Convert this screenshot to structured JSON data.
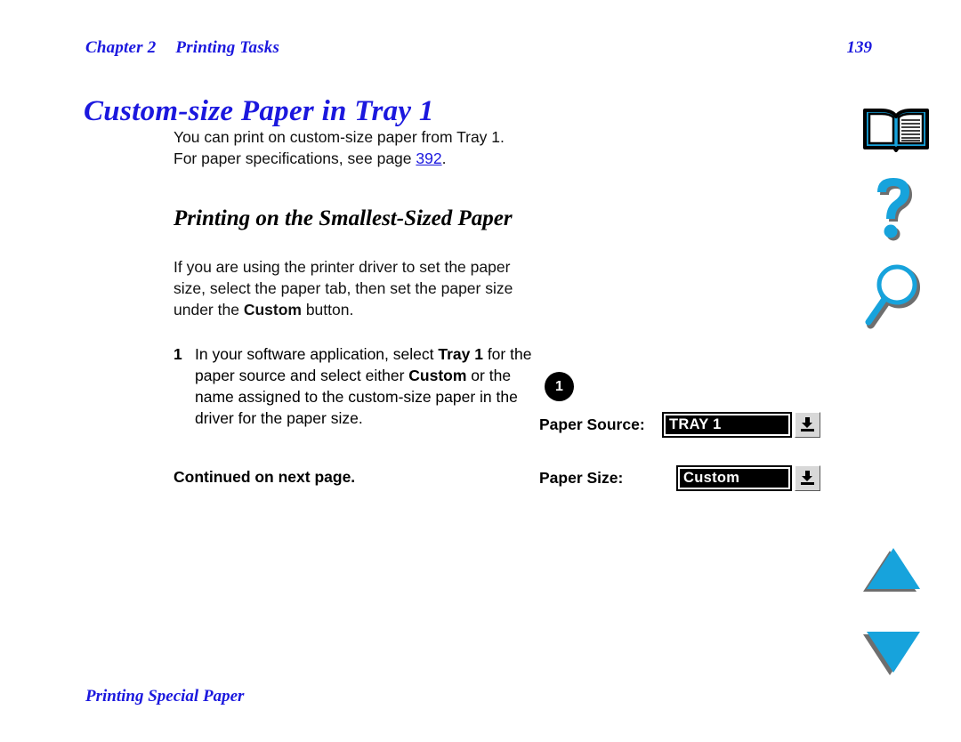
{
  "document": {
    "running_head": {
      "chapter": "Chapter 2",
      "section": "Printing Tasks"
    },
    "page_number": "139",
    "title": "Custom-size Paper in Tray 1",
    "footer": "Printing Special Paper"
  },
  "content": {
    "intro_paragraph_part1": "You can print on custom-size paper from Tray 1. For paper specifications, see page ",
    "intro_link": "392",
    "intro_paragraph_part2": ".",
    "subheading": "Printing on the Smallest-Sized Paper",
    "driver_paragraph_part1": "If you are using the printer driver to set the paper size, select the paper tab, then set the paper size under the ",
    "driver_paragraph_bold": "Custom",
    "driver_paragraph_part2": " button.",
    "step": {
      "number": "1",
      "text_part1": "In your software application, select ",
      "bold1": "Tray 1",
      "text_part2": " for the paper source and select either ",
      "bold2": "Custom",
      "text_part3": " or the name assigned to the custom-size paper in the driver for the paper size."
    },
    "continued_note": "Continued on next page."
  },
  "figure": {
    "callout_number": "1",
    "fields": [
      {
        "label": "Paper Source:",
        "value": "TRAY 1",
        "dropdown_icon": "dropdown-arrow-icon"
      },
      {
        "label": "Paper Size:",
        "value": "Custom",
        "dropdown_icon": "dropdown-arrow-icon"
      }
    ]
  },
  "icon_rail": {
    "items": [
      {
        "name": "book-icon",
        "meaning": "Table of contents"
      },
      {
        "name": "help-icon",
        "meaning": "Help"
      },
      {
        "name": "search-icon",
        "meaning": "Search"
      }
    ],
    "nav": [
      {
        "name": "previous-page-icon",
        "meaning": "Previous page"
      },
      {
        "name": "next-page-icon",
        "meaning": "Next page"
      }
    ]
  },
  "colors": {
    "heading_blue": "#1B18DE",
    "icon_cyan": "#17A3DC",
    "icon_shadow": "#6E6E6E",
    "link_blue": "#1B18DE"
  }
}
